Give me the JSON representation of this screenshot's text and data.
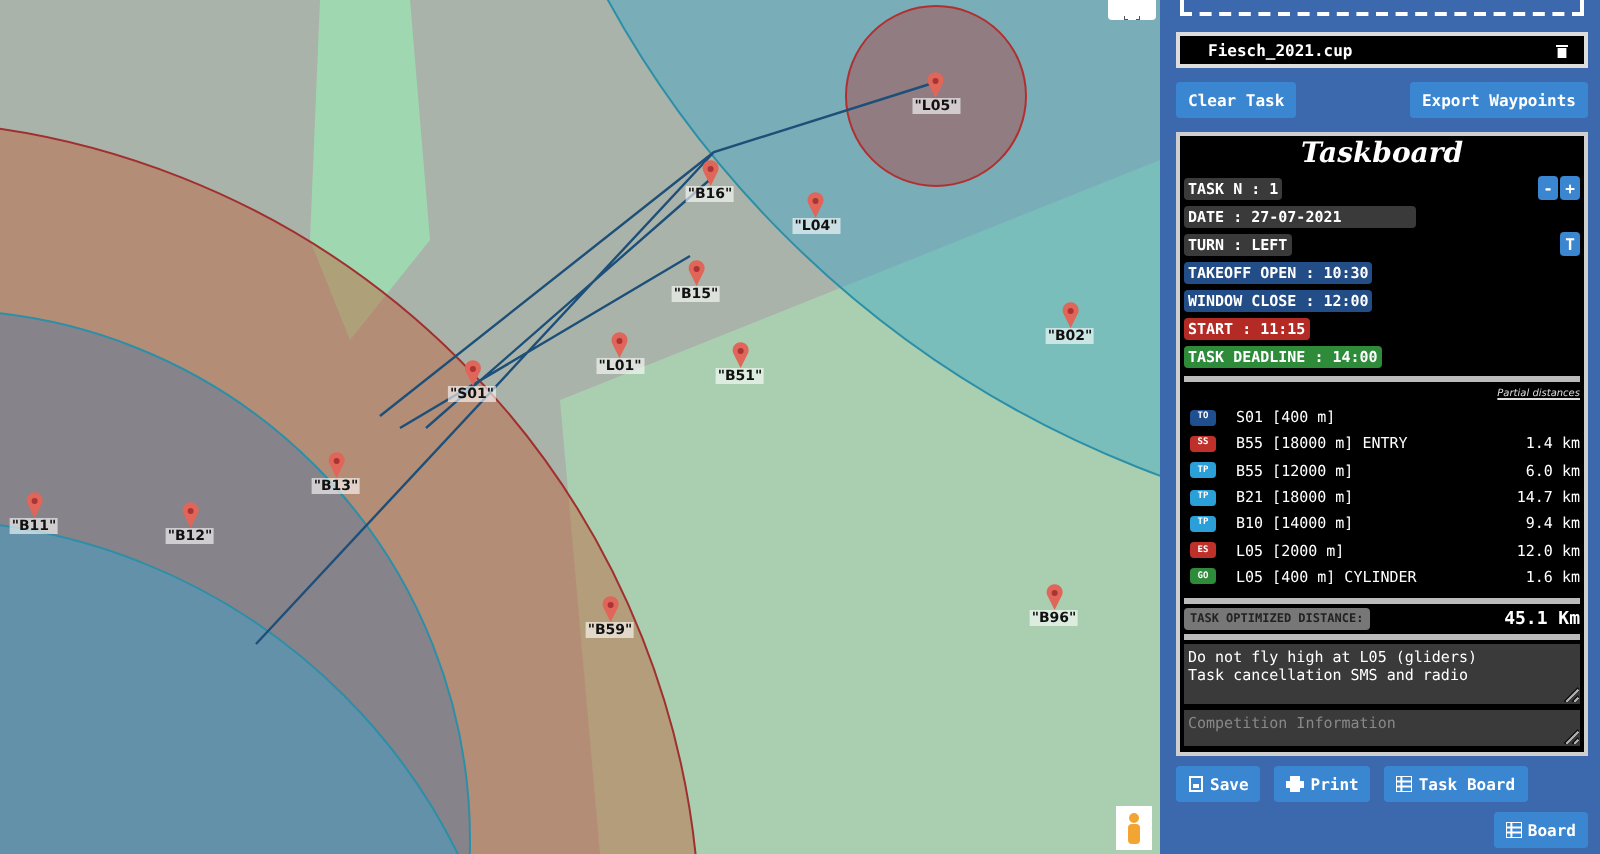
{
  "map": {
    "waypoints": [
      {
        "label": "\"B16\""
      },
      {
        "label": "\"L04\""
      },
      {
        "label": "\"L05\""
      },
      {
        "label": "\"B15\""
      },
      {
        "label": "\"L01\""
      },
      {
        "label": "\"B51\""
      },
      {
        "label": "\"B02\""
      },
      {
        "label": "\"S01\""
      },
      {
        "label": "\"B11\""
      },
      {
        "label": "\"B12\""
      },
      {
        "label": "\"B13\""
      },
      {
        "label": "\"B59\""
      },
      {
        "label": "\"B96\""
      }
    ]
  },
  "panel": {
    "file": {
      "name": "Fiesch_2021.cup"
    },
    "actions": [
      "Clear Task",
      "Export Waypoints"
    ],
    "taskboard": {
      "title": "Taskboard",
      "fields": [
        {
          "kind": "plain",
          "text": "TASK N : 1",
          "buttons": [
            "-",
            "+"
          ]
        },
        {
          "kind": "wide",
          "text": "DATE : 27-07-2021"
        },
        {
          "kind": "plain",
          "text": "TURN : LEFT",
          "buttons": [
            "T"
          ]
        },
        {
          "kind": "blue",
          "text": "TAKEOFF OPEN : 10:30"
        },
        {
          "kind": "blue",
          "text": "WINDOW CLOSE : 12:00"
        },
        {
          "kind": "red",
          "text": "START : 11:15"
        },
        {
          "kind": "green",
          "text": "TASK DEADLINE : 14:00"
        }
      ],
      "partial_header": "Partial distances",
      "turnpoints": [
        {
          "type": "TO",
          "name": "S01 [400 m]"
        },
        {
          "type": "SS",
          "name": "B55 [18000 m] ENTRY",
          "distance": "1.4 km"
        },
        {
          "type": "TP",
          "name": "B55 [12000 m]",
          "distance": "6.0 km"
        },
        {
          "type": "TP",
          "name": "B21 [18000 m]",
          "distance": "14.7 km"
        },
        {
          "type": "TP",
          "name": "B10 [14000 m]",
          "distance": "9.4 km"
        },
        {
          "type": "ES",
          "name": "L05 [2000 m]",
          "distance": "12.0 km"
        },
        {
          "type": "GO",
          "name": "L05 [400 m] CYLINDER",
          "distance": "1.6 km"
        }
      ],
      "optimized": {
        "label": "TASK OPTIMIZED DISTANCE:",
        "value": "45.1 Km"
      },
      "notes": {
        "value": "Do not fly high at L05 (gliders)\nTask cancellation SMS and radio"
      },
      "info": {
        "placeholder": "Competition Information"
      }
    },
    "buttons": [
      {
        "kind": "save",
        "label": "Save"
      },
      {
        "kind": "print",
        "label": "Print"
      },
      {
        "kind": "grid",
        "label": "Task Board"
      }
    ],
    "board_button": {
      "label": "Board"
    }
  }
}
